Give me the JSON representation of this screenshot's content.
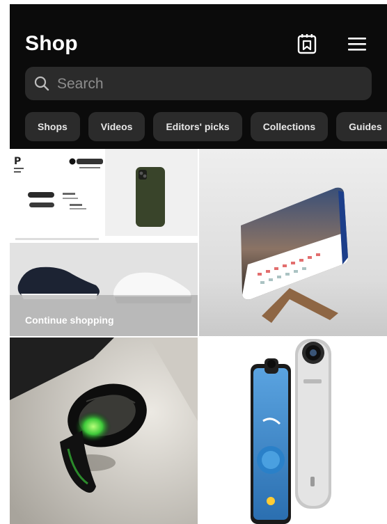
{
  "header": {
    "title": "Shop",
    "wishlist_icon": "bookmark-calendar-icon",
    "menu_icon": "hamburger-menu-icon"
  },
  "search": {
    "placeholder": "Search",
    "icon": "search-icon"
  },
  "tabs": [
    {
      "label": "Shops"
    },
    {
      "label": "Videos"
    },
    {
      "label": "Editors' picks"
    },
    {
      "label": "Collections"
    },
    {
      "label": "Guides"
    }
  ],
  "grid": {
    "tile1": {
      "overlay_label": "Continue shopping",
      "content": "case-and-sneakers-collage"
    },
    "tile2": {
      "content": "tablet-keyboard-on-wooden-stand"
    },
    "tile3": {
      "content": "glowing-smart-ring"
    },
    "tile4": {
      "content": "360-camera-attached-to-phone"
    }
  },
  "colors": {
    "header_bg": "#0b0b0b",
    "chip_bg": "#2b2b2b",
    "text_primary": "#ffffff"
  }
}
